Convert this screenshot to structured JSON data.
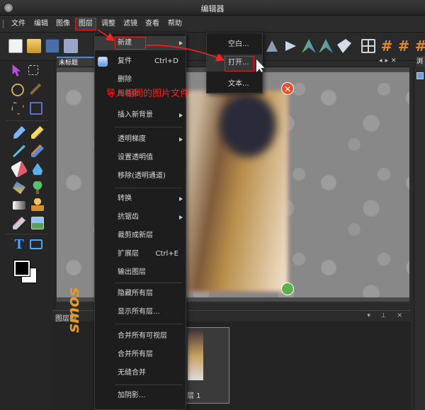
{
  "window": {
    "title": "编辑器"
  },
  "menubar": {
    "items": [
      {
        "label": "文件"
      },
      {
        "label": "编辑"
      },
      {
        "label": "图像"
      },
      {
        "label": "图层"
      },
      {
        "label": "调整"
      },
      {
        "label": "滤镜"
      },
      {
        "label": "查看"
      },
      {
        "label": "帮助"
      }
    ],
    "active": "图层"
  },
  "document": {
    "tab_label": "未标题"
  },
  "right_panel": {
    "tab_label": "浏"
  },
  "layers_panel": {
    "title": "图层列",
    "layer_name": "层 1"
  },
  "layer_menu": {
    "items": [
      {
        "label": "新建",
        "shortcut": "",
        "submenu": true
      },
      {
        "label": "复件",
        "shortcut": "Ctrl+D",
        "submenu": false
      },
      {
        "label": "删除",
        "shortcut": "",
        "submenu": false
      },
      {
        "label": "栅格化",
        "shortcut": "",
        "submenu": false
      },
      {
        "label": "插入新背景",
        "shortcut": "",
        "submenu": true
      },
      {
        "label": "透明梯度",
        "shortcut": "",
        "submenu": true
      },
      {
        "label": "设置透明值",
        "shortcut": "",
        "submenu": false
      },
      {
        "label": "移除(透明通道)",
        "shortcut": "",
        "submenu": false
      },
      {
        "label": "转换",
        "shortcut": "",
        "submenu": true
      },
      {
        "label": "抗锯齿",
        "shortcut": "",
        "submenu": true
      },
      {
        "label": "裁剪成新层",
        "shortcut": "",
        "submenu": false
      },
      {
        "label": "扩展层",
        "shortcut": "Ctrl+E",
        "submenu": false
      },
      {
        "label": "输出图层",
        "shortcut": "",
        "submenu": false
      },
      {
        "label": "隐藏所有层",
        "shortcut": "",
        "submenu": false
      },
      {
        "label": "显示所有层...",
        "shortcut": "",
        "submenu": false
      },
      {
        "label": "合并所有可视层",
        "shortcut": "",
        "submenu": false
      },
      {
        "label": "合并所有层",
        "shortcut": "",
        "submenu": false
      },
      {
        "label": "无缝合并",
        "shortcut": "",
        "submenu": false
      },
      {
        "label": "加阴影...",
        "shortcut": "",
        "submenu": false
      }
    ]
  },
  "new_submenu": {
    "items": [
      {
        "label": "空白..."
      },
      {
        "label": "打开..."
      },
      {
        "label": "文本..."
      }
    ]
  },
  "annotation": {
    "text": "导入相同的图片文件",
    "color": "#ff2020"
  },
  "brand_text": "smos",
  "colors": {
    "highlight_box": "#e02020",
    "menu_bg": "#1d1d1d",
    "brand": "#e49a2a"
  }
}
